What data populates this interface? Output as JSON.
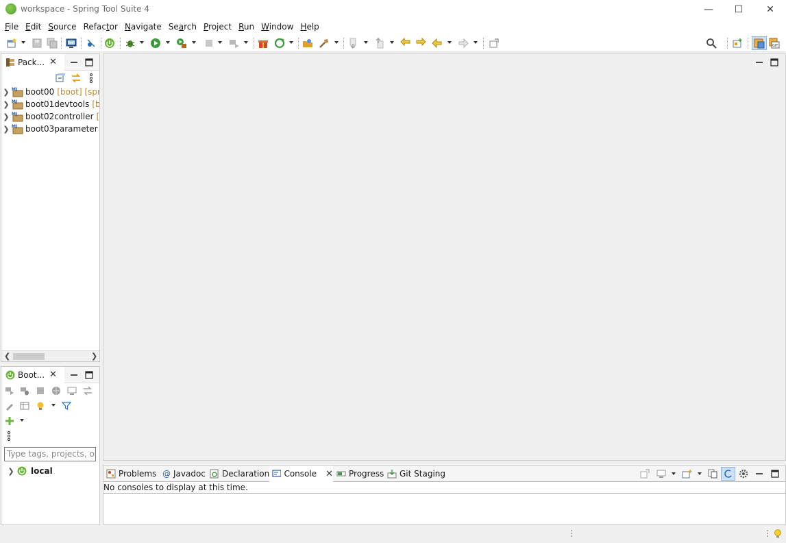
{
  "window": {
    "title": "workspace - Spring Tool Suite 4",
    "controls": {
      "minimize": "—",
      "maximize": "☐",
      "close": "✕"
    }
  },
  "menu": [
    {
      "label": "File",
      "mnemonic": "F",
      "rest": "ile"
    },
    {
      "label": "Edit",
      "mnemonic": "E",
      "rest": "dit"
    },
    {
      "label": "Source",
      "mnemonic": "S",
      "rest": "ource"
    },
    {
      "label": "Refactor",
      "pre": "Refac",
      "mnemonic": "t",
      "rest": "or"
    },
    {
      "label": "Navigate",
      "mnemonic": "N",
      "rest": "avigate"
    },
    {
      "label": "Search",
      "pre": "Se",
      "mnemonic": "a",
      "rest": "rch"
    },
    {
      "label": "Project",
      "mnemonic": "P",
      "rest": "roject"
    },
    {
      "label": "Run",
      "mnemonic": "R",
      "rest": "un"
    },
    {
      "label": "Window",
      "mnemonic": "W",
      "rest": "indow"
    },
    {
      "label": "Help",
      "mnemonic": "H",
      "rest": "elp"
    }
  ],
  "package_explorer": {
    "tab_label": "Pack...",
    "projects": [
      {
        "name": "boot00",
        "decoration": "[boot] [spri"
      },
      {
        "name": "boot01devtools",
        "decoration": "[bc"
      },
      {
        "name": "boot02controller",
        "decoration": "[b"
      },
      {
        "name": "boot03parameter",
        "decoration": "[b"
      }
    ]
  },
  "boot_dashboard": {
    "tab_label": "Boot...",
    "filter_placeholder": "Type tags, projects, or w",
    "tree": [
      {
        "label": "local"
      }
    ]
  },
  "bottom_tabs": [
    {
      "label": "Problems",
      "icon": "problems-icon"
    },
    {
      "label": "Javadoc",
      "icon": "javadoc-icon",
      "glyph": "@"
    },
    {
      "label": "Declaration",
      "icon": "declaration-icon"
    },
    {
      "label": "Console",
      "icon": "console-icon",
      "active": true
    },
    {
      "label": "Progress",
      "icon": "progress-icon"
    },
    {
      "label": "Git Staging",
      "icon": "git-staging-icon"
    }
  ],
  "console": {
    "message": "No consoles to display at this time."
  },
  "colors": {
    "spring_green": "#6db33f",
    "accent_blue": "#2a6ebb",
    "panel_border": "#c9c9c9"
  }
}
